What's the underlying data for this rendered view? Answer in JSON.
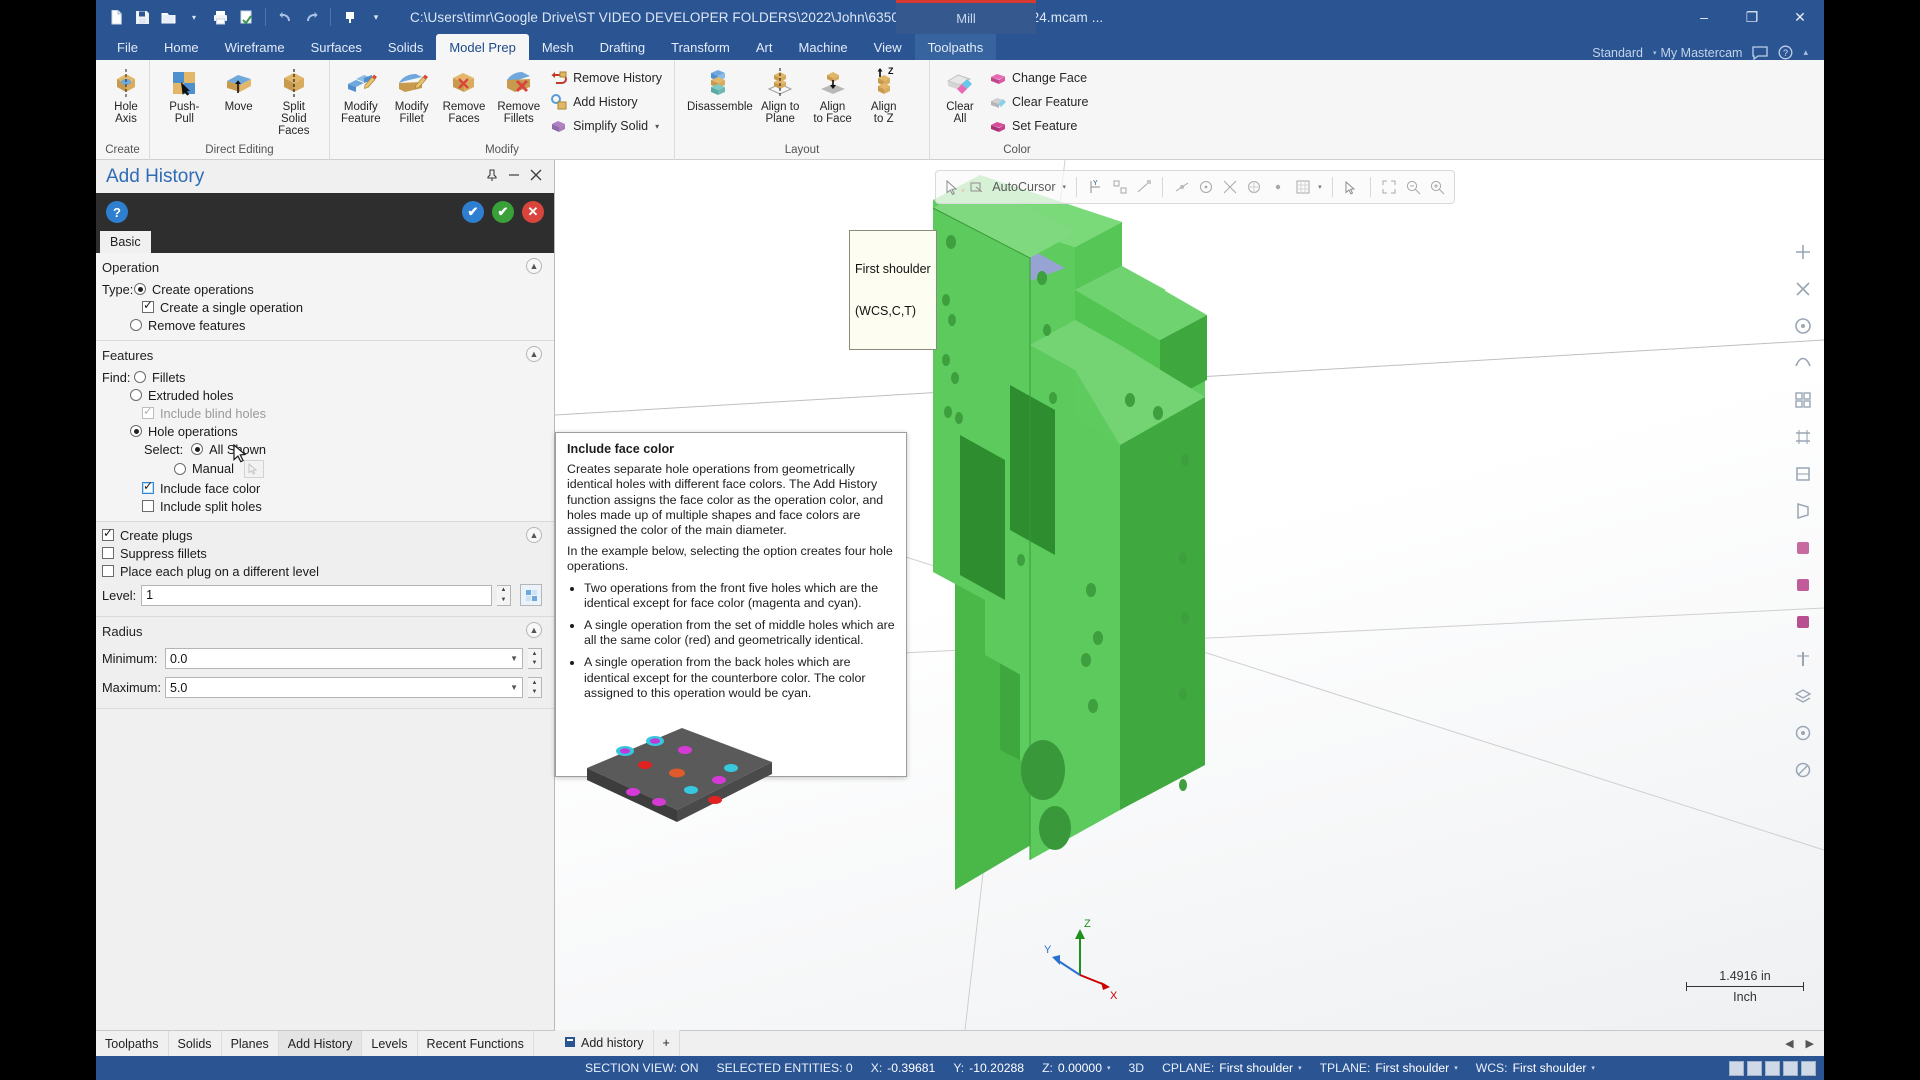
{
  "window": {
    "title": "C:\\Users\\timr\\Google Drive\\ST VIDEO DEVELOPER FOLDERS\\2022\\John\\6350-24 Add History\\6350-24.mcam ...",
    "product_tab": "Mill",
    "minimize": "–",
    "maximize": "❐",
    "close": "✕"
  },
  "quick_access": [
    {
      "name": "new-icon",
      "label": "New"
    },
    {
      "name": "save-icon",
      "label": "Save"
    },
    {
      "name": "open-icon",
      "label": "Open"
    },
    {
      "name": "print-icon",
      "label": "Print"
    },
    {
      "name": "print-preview-icon",
      "label": "Print Preview"
    },
    {
      "name": "undo-icon",
      "label": "Undo"
    },
    {
      "name": "redo-icon",
      "label": "Redo"
    },
    {
      "name": "customize-icon",
      "label": "Customize Quick Access Toolbar"
    }
  ],
  "ribbon": {
    "tabs": [
      {
        "label": "File",
        "active": false
      },
      {
        "label": "Home",
        "active": false
      },
      {
        "label": "Wireframe",
        "active": false
      },
      {
        "label": "Surfaces",
        "active": false
      },
      {
        "label": "Solids",
        "active": false
      },
      {
        "label": "Model Prep",
        "active": true
      },
      {
        "label": "Mesh",
        "active": false
      },
      {
        "label": "Drafting",
        "active": false
      },
      {
        "label": "Transform",
        "active": false
      },
      {
        "label": "Art",
        "active": false
      },
      {
        "label": "Machine",
        "active": false
      },
      {
        "label": "View",
        "active": false
      },
      {
        "label": "Toolpaths",
        "active": false
      }
    ],
    "right": {
      "config": "Standard",
      "my_mastercam": "My Mastercam",
      "chat_icon": "chat-icon",
      "help_icon": "help-icon",
      "collapse_icon": "collapse-ribbon-icon"
    },
    "groups": [
      {
        "name": "Create",
        "big": [
          {
            "label": "Hole\nAxis",
            "icon": "hole-axis-icon"
          }
        ],
        "small": []
      },
      {
        "name": "Direct Editing",
        "big": [
          {
            "label": "Push-Pull",
            "icon": "push-pull-icon"
          },
          {
            "label": "Move",
            "icon": "move-icon"
          },
          {
            "label": "Split Solid\nFaces",
            "icon": "split-solid-faces-icon"
          }
        ],
        "small": []
      },
      {
        "name": "Modify",
        "big": [
          {
            "label": "Modify\nFeature",
            "icon": "modify-feature-icon"
          },
          {
            "label": "Modify\nFillet",
            "icon": "modify-fillet-icon"
          },
          {
            "label": "Remove\nFaces",
            "icon": "remove-faces-icon"
          },
          {
            "label": "Remove\nFillets",
            "icon": "remove-fillets-icon"
          }
        ],
        "small": [
          {
            "label": "Remove History",
            "icon": "remove-history-icon",
            "caret": false
          },
          {
            "label": "Add History",
            "icon": "add-history-icon",
            "caret": false
          },
          {
            "label": "Simplify Solid",
            "icon": "simplify-solid-icon",
            "caret": true
          }
        ]
      },
      {
        "name": "Layout",
        "big": [
          {
            "label": "Disassemble",
            "icon": "disassemble-icon"
          },
          {
            "label": "Align to\nPlane",
            "icon": "align-to-plane-icon"
          },
          {
            "label": "Align\nto Face",
            "icon": "align-to-face-icon"
          },
          {
            "label": "Align\nto Z",
            "icon": "align-to-z-icon"
          }
        ],
        "small": []
      },
      {
        "name": "Color",
        "big": [
          {
            "label": "Clear\nAll",
            "icon": "clear-all-icon"
          }
        ],
        "small": [
          {
            "label": "Change Face",
            "icon": "change-face-icon",
            "caret": false
          },
          {
            "label": "Clear Feature",
            "icon": "clear-feature-icon",
            "caret": false
          },
          {
            "label": "Set Feature",
            "icon": "set-feature-icon",
            "caret": false
          }
        ]
      }
    ]
  },
  "panel": {
    "title": "Add History",
    "pin_icon": "pin-icon",
    "minimize_icon": "panel-minimize-icon",
    "close_icon": "panel-close-icon",
    "toolbar": {
      "help": "?",
      "ok_apply": "✔",
      "ok": "✔",
      "cancel": "✕"
    },
    "tabs": [
      {
        "label": "Basic",
        "active": true
      }
    ],
    "sections": {
      "operation": {
        "title": "Operation",
        "type_label": "Type:",
        "options": [
          {
            "label": "Create operations",
            "type": "radio",
            "checked": true,
            "indent": 0
          },
          {
            "label": "Create a single operation",
            "type": "checkbox",
            "checked": true,
            "indent": 1
          },
          {
            "label": "Remove features",
            "type": "radio",
            "checked": false,
            "indent": 0
          }
        ]
      },
      "features": {
        "title": "Features",
        "find_label": "Find:",
        "options": [
          {
            "label": "Fillets",
            "type": "radio",
            "checked": false,
            "indent": 0,
            "dim": false
          },
          {
            "label": "Extruded holes",
            "type": "radio",
            "checked": false,
            "indent": 0,
            "dim": false
          },
          {
            "label": "Include blind holes",
            "type": "checkbox",
            "checked": true,
            "indent": 1,
            "dim": true
          },
          {
            "label": "Hole operations",
            "type": "radio",
            "checked": true,
            "indent": 0,
            "dim": false
          }
        ],
        "select_label": "Select:",
        "select_options": [
          {
            "label": "All Shown",
            "type": "radio",
            "checked": true
          },
          {
            "label": "Manual",
            "type": "radio",
            "checked": false
          }
        ],
        "manual_pick_icon": "manual-select-icon",
        "extra": [
          {
            "label": "Include face color",
            "type": "checkbox",
            "checked": true,
            "highlight": true
          },
          {
            "label": "Include split holes",
            "type": "checkbox",
            "checked": false,
            "highlight": false
          }
        ]
      },
      "plugs": {
        "options": [
          {
            "label": "Create plugs",
            "type": "checkbox",
            "checked": true
          },
          {
            "label": "Suppress fillets",
            "type": "checkbox",
            "checked": false
          },
          {
            "label": "Place each plug on a different level",
            "type": "checkbox",
            "checked": false
          }
        ],
        "level_label": "Level:",
        "level_value": "1",
        "level_picker_icon": "level-picker-icon"
      },
      "radius": {
        "title": "Radius",
        "minimum_label": "Minimum:",
        "minimum_value": "0.0",
        "maximum_label": "Maximum:",
        "maximum_value": "5.0"
      }
    }
  },
  "help_popup": {
    "title": "Include face color",
    "paragraphs": [
      "Creates separate hole operations from geometrically identical holes with different face colors. The Add History function assigns the face color as the operation color, and holes made up of multiple shapes and face colors are assigned the color of the main diameter.",
      "In the example below, selecting the option creates four hole operations."
    ],
    "bullets": [
      "Two operations from the front five holes which are the identical except for face color (magenta and cyan).",
      "A single operation from the set of middle holes which are all the same color (red) and geometrically identical.",
      "A single operation from the back holes which are identical except for the counterbore color. The color assigned to this operation would be cyan."
    ],
    "image_name": "example-plate-with-colored-holes-image"
  },
  "graphics": {
    "floating_toolbar": {
      "autocursor_label": "AutoCursor",
      "icons": [
        "cursor-icon",
        "autocursor-icon",
        "axis-y-icon",
        "snap-icon",
        "endpoint-icon",
        "midpoint-icon",
        "center-icon",
        "intersection-icon",
        "quadrant-icon",
        "point-icon",
        "grid-icon",
        "select-icon",
        "fit-icon",
        "unzoom-icon",
        "zoom-window-icon"
      ]
    },
    "annotation": {
      "line1": "First shoulder",
      "line2": "(WCS,C,T)"
    },
    "axis_labels": {
      "x": "X",
      "y": "Y",
      "z": "Z"
    },
    "scale": {
      "value": "1.4916 in",
      "unit": "Inch"
    },
    "model_color": "#4cc04c",
    "right_toolbar_icons": [
      "fit-screen-icon",
      "unzoom-icon",
      "zoom-target-icon",
      "dynamic-rotate-icon",
      "isometric-view-icon",
      "top-view-icon",
      "front-view-icon",
      "right-view-icon",
      "wireframe-icon",
      "shaded-icon",
      "shaded-wireframe-icon",
      "section-view-icon",
      "levels-icon",
      "blank-icon",
      "unblank-icon"
    ]
  },
  "bottom_tabs": [
    {
      "label": "Toolpaths",
      "active": false
    },
    {
      "label": "Solids",
      "active": false
    },
    {
      "label": "Planes",
      "active": false
    },
    {
      "label": "Add History",
      "active": true
    },
    {
      "label": "Levels",
      "active": false
    },
    {
      "label": "Recent Functions",
      "active": false
    }
  ],
  "graphics_tabs": [
    {
      "label": "Add history",
      "icon": "add-history-tab-icon",
      "active": true
    },
    {
      "label": "+",
      "icon": "new-tab-icon",
      "active": false
    }
  ],
  "statusbar": {
    "section_view": "SECTION VIEW: ON",
    "selected_entities": "SELECTED ENTITIES: 0",
    "x_label": "X:",
    "x_value": "-0.39681",
    "y_label": "Y:",
    "y_value": "-10.20288",
    "z_label": "Z:",
    "z_value": "0.00000",
    "mode": "3D",
    "cplane_label": "CPLANE:",
    "cplane_value": "First shoulder",
    "tplane_label": "TPLANE:",
    "tplane_value": "First shoulder",
    "wcs_label": "WCS:",
    "wcs_value": "First shoulder"
  },
  "colors": {
    "accent_blue": "#2b5493",
    "panel_title_blue": "#2f6cb5",
    "model_green": "#4cc04c",
    "ok_green": "#3aa03a",
    "cancel_red": "#d9453c",
    "mill_red": "#d63a2f"
  }
}
